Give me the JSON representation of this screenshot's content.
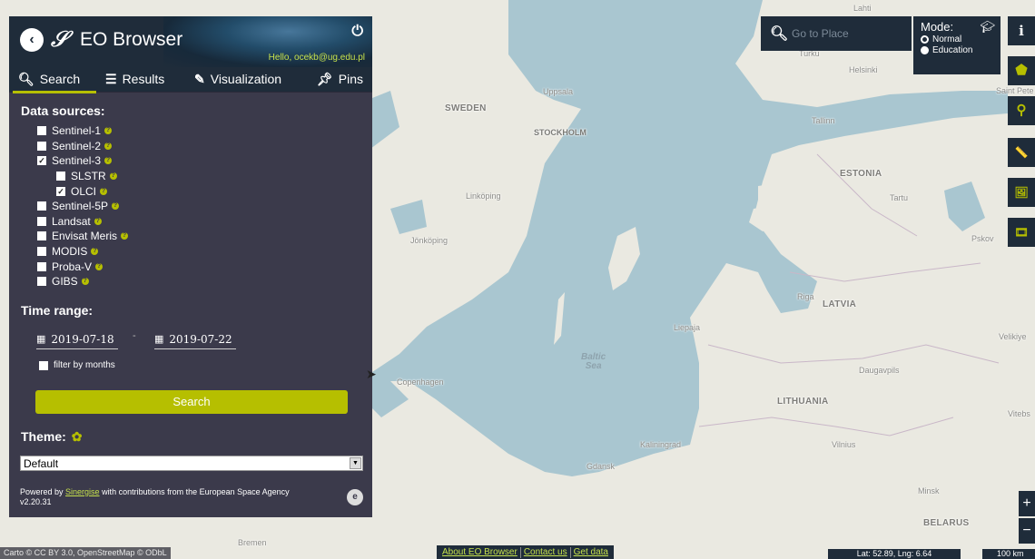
{
  "map": {
    "cities": [
      {
        "name": "Lahti",
        "id": "lahti"
      },
      {
        "name": "Turku",
        "id": "turku"
      },
      {
        "name": "Helsinki",
        "id": "helsinki"
      },
      {
        "name": "Saint Pete",
        "id": "stpete"
      },
      {
        "name": "Uppsala",
        "id": "uppsala"
      },
      {
        "name": "STOCKHOLM",
        "id": "stockholm"
      },
      {
        "name": "Tallinn",
        "id": "tallinn"
      },
      {
        "name": "Tartu",
        "id": "tartu"
      },
      {
        "name": "Linköping",
        "id": "linkoping"
      },
      {
        "name": "Jönköping",
        "id": "jonkoping"
      },
      {
        "name": "Pskov",
        "id": "pskov"
      },
      {
        "name": "Riga",
        "id": "riga"
      },
      {
        "name": "Liepaja",
        "id": "liepaja"
      },
      {
        "name": "Velikiye",
        "id": "velikiye"
      },
      {
        "name": "Copenhagen",
        "id": "copenhagen"
      },
      {
        "name": "Daugavpils",
        "id": "daugavpils"
      },
      {
        "name": "Vitebs",
        "id": "vitebsk"
      },
      {
        "name": "Kaliningrad",
        "id": "kaliningrad"
      },
      {
        "name": "Vilnius",
        "id": "vilnius"
      },
      {
        "name": "Gdansk",
        "id": "gdansk"
      },
      {
        "name": "Minsk",
        "id": "minsk"
      },
      {
        "name": "Bremen",
        "id": "bremen"
      }
    ],
    "countries": [
      {
        "name": "SWEDEN",
        "id": "sweden"
      },
      {
        "name": "ESTONIA",
        "id": "estonia"
      },
      {
        "name": "LATVIA",
        "id": "latvia"
      },
      {
        "name": "LITHUANIA",
        "id": "lithuania"
      },
      {
        "name": "BELARUS",
        "id": "belarus"
      }
    ],
    "sea_label": "Baltic\nSea"
  },
  "panel": {
    "app_title": "EO Browser",
    "hello": "Hello, ocekb@ug.edu.pl",
    "tabs": [
      {
        "label": "Search",
        "icon": "search-icon",
        "active": true
      },
      {
        "label": "Results",
        "icon": "list-icon",
        "active": false
      },
      {
        "label": "Visualization",
        "icon": "brush-icon",
        "active": false
      },
      {
        "label": "Pins",
        "icon": "pin-icon",
        "active": false
      }
    ],
    "data_sources_title": "Data sources:",
    "data_sources": [
      {
        "label": "Sentinel-1",
        "checked": false,
        "sub": false
      },
      {
        "label": "Sentinel-2",
        "checked": false,
        "sub": false
      },
      {
        "label": "Sentinel-3",
        "checked": true,
        "sub": false
      },
      {
        "label": "SLSTR",
        "checked": false,
        "sub": true
      },
      {
        "label": "OLCI",
        "checked": true,
        "sub": true
      },
      {
        "label": "Sentinel-5P",
        "checked": false,
        "sub": false
      },
      {
        "label": "Landsat",
        "checked": false,
        "sub": false
      },
      {
        "label": "Envisat Meris",
        "checked": false,
        "sub": false
      },
      {
        "label": "MODIS",
        "checked": false,
        "sub": false
      },
      {
        "label": "Proba-V",
        "checked": false,
        "sub": false
      },
      {
        "label": "GIBS",
        "checked": false,
        "sub": false
      }
    ],
    "time_range_title": "Time range:",
    "date_from": "2019-07-18",
    "date_sep": "-",
    "date_to": "2019-07-22",
    "filter_by_months": "filter by months",
    "search_button": "Search",
    "theme_title": "Theme:",
    "theme_value": "Default",
    "footer_powered": "Powered by ",
    "footer_link": "Sinergise",
    "footer_rest": " with contributions from the European Space Agency",
    "footer_version": "v2.20.31"
  },
  "place_search": {
    "placeholder": "Go to Place"
  },
  "mode": {
    "title": "Mode:",
    "options": [
      {
        "label": "Normal",
        "selected": true
      },
      {
        "label": "Education",
        "selected": false
      }
    ]
  },
  "side_tools": [
    {
      "name": "info-button",
      "icon": "info-icon",
      "glyph": "i"
    },
    {
      "name": "draw-aoi-button",
      "icon": "pentagon-icon",
      "glyph": "⬟"
    },
    {
      "name": "pin-location-button",
      "icon": "map-marker-icon",
      "glyph": "⚲"
    },
    {
      "name": "measure-button",
      "icon": "ruler-icon",
      "glyph": "📏"
    },
    {
      "name": "image-download-button",
      "icon": "image-download-icon",
      "glyph": "🖼"
    },
    {
      "name": "timelapse-button",
      "icon": "film-icon",
      "glyph": "🎞"
    }
  ],
  "zoom": {
    "in": "+",
    "out": "−"
  },
  "attribution": "Carto © CC BY 3.0, OpenStreetMap © ODbL",
  "bottom_links": [
    "About EO Browser",
    "Contact us",
    "Get data"
  ],
  "coords": "Lat: 52.89, Lng: 6.64",
  "scale": "100 km",
  "colors": {
    "accent": "#b6bf00",
    "panel_bg": "#3b3a4b",
    "header_bg": "#1f2c3a",
    "water": "#a9c6d0",
    "land": "#eae9e1"
  }
}
